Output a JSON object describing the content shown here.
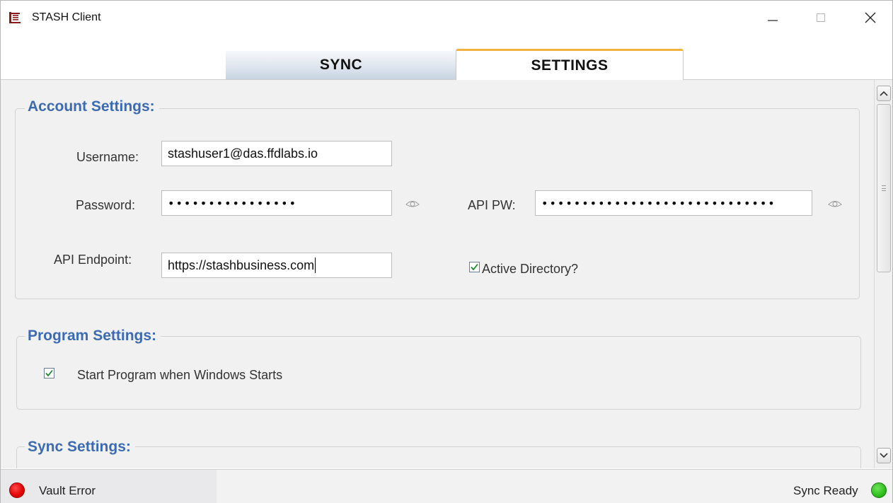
{
  "window": {
    "title": "STASH Client"
  },
  "tabs": [
    {
      "label": "SYNC",
      "active": false
    },
    {
      "label": "SETTINGS",
      "active": true
    }
  ],
  "account_settings": {
    "title": "Account Settings:",
    "username_label": "Username:",
    "username_value": "stashuser1@das.ffdlabs.io",
    "password_label": "Password:",
    "password_value": "••••••••••••••••",
    "api_pw_label": "API PW:",
    "api_pw_value": "•••••••••••••••••••••••••••••",
    "api_endpoint_label": "API Endpoint:",
    "api_endpoint_value": "https://stashbusiness.com",
    "active_directory_label": "Active Directory?",
    "active_directory_checked": true
  },
  "program_settings": {
    "title": "Program Settings:",
    "start_with_windows_label": "Start Program when Windows Starts",
    "start_with_windows_checked": true
  },
  "sync_settings": {
    "title": "Sync Settings:"
  },
  "status": {
    "left_text": "Vault Error",
    "left_color": "#e00000",
    "right_text": "Sync Ready",
    "right_color": "#2fbf1c"
  },
  "colors": {
    "section_title": "#3d6bb3",
    "active_tab_accent": "#f2b140",
    "checkbox_check": "#1e8a2c"
  }
}
